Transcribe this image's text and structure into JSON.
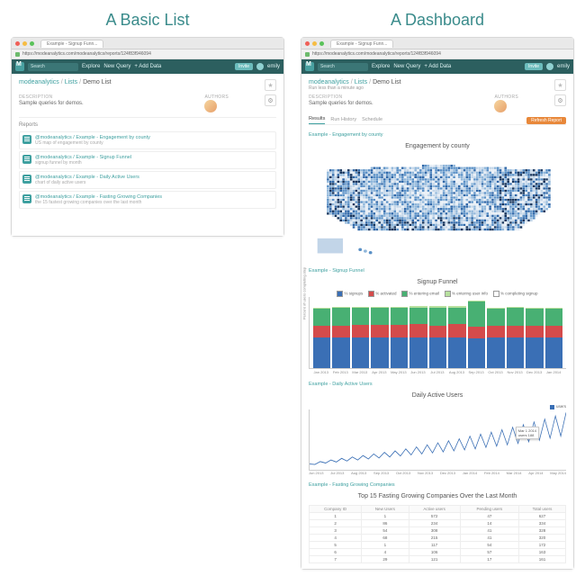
{
  "left": {
    "title": "A Basic List",
    "tab": "Example - Signup Funn...",
    "url": "https://modeanalytics.com/modeanalytics/reports/124f83f946094",
    "nav": {
      "search": "Search",
      "explore": "Explore",
      "new_query": "New Query",
      "add_data": "+ Add Data",
      "invite": "Invite",
      "user": "emily"
    },
    "breadcrumb": {
      "a": "modeanalytics",
      "b": "Lists",
      "c": "Demo List"
    },
    "description_label": "DESCRIPTION",
    "description": "Sample queries for demos.",
    "authors_label": "AUTHORS",
    "reports_header": "Reports",
    "reports": [
      {
        "owner": "@modeanalytics",
        "title": "Example - Engagement by county",
        "sub": "US map of engagement by county"
      },
      {
        "owner": "@modeanalytics",
        "title": "Example - Signup Funnel",
        "sub": "signup funnel by month"
      },
      {
        "owner": "@modeanalytics",
        "title": "Example - Daily Active Users",
        "sub": "chart of daily active users"
      },
      {
        "owner": "@modeanalytics",
        "title": "Example - Fasting Growing Companies",
        "sub": "the 15 fastest growing companies over the last month"
      }
    ]
  },
  "right": {
    "title": "A Dashboard",
    "tab": "Example - Signup Funn...",
    "url": "https://modeanalytics.com/modeanalytics/reports/124f83f946094",
    "nav": {
      "search": "Search",
      "explore": "Explore",
      "new_query": "New Query",
      "add_data": "+ Add Data",
      "invite": "Invite",
      "user": "emily"
    },
    "breadcrumb": {
      "a": "modeanalytics",
      "b": "Lists",
      "c": "Demo List"
    },
    "runtime": "Run less than a minute ago",
    "description_label": "DESCRIPTION",
    "description": "Sample queries for demos.",
    "authors_label": "AUTHORS",
    "tabs": {
      "results": "Results",
      "history": "Run History",
      "schedule": "Schedule",
      "refresh": "Refresh Report"
    },
    "sections": {
      "map": "Example - Engagement by county",
      "funnel": "Example - Signup Funnel",
      "dau": "Example - Daily Active Users",
      "table": "Example - Fasting Growing Companies"
    },
    "map_title": "Engagement by county",
    "funnel_title": "Signup Funnel",
    "dau_title": "Daily Active Users",
    "dau_legend": "users",
    "dau_tooltip": {
      "date": "Mar 1 2014",
      "label": "users",
      "val": "188"
    },
    "table_title": "Top 15 Fasting Growing Companies Over the Last Month"
  },
  "chart_data": [
    {
      "type": "bar",
      "name": "Signup Funnel",
      "ylabel": "Percent of users completing step",
      "ylim": [
        0,
        100
      ],
      "categories": [
        "Jan 2013",
        "Feb 2013",
        "Mar 2013",
        "Apr 2013",
        "May 2013",
        "Jun 2013",
        "Jul 2013",
        "Aug 2013",
        "Sep 2013",
        "Oct 2013",
        "Nov 2013",
        "Dec 2013",
        "Jan 2014"
      ],
      "series": [
        {
          "name": "% signups",
          "color": "#3a6fb5",
          "values": [
            45,
            45,
            45,
            45,
            46,
            46,
            45,
            46,
            44,
            45,
            45,
            45,
            45
          ]
        },
        {
          "name": "% activated",
          "color": "#d44b4b",
          "values": [
            18,
            18,
            19,
            19,
            18,
            19,
            18,
            19,
            17,
            18,
            18,
            18,
            18
          ]
        },
        {
          "name": "% entering email",
          "color": "#48b073",
          "values": [
            25,
            26,
            25,
            25,
            25,
            25,
            27,
            25,
            38,
            25,
            26,
            25,
            25
          ]
        },
        {
          "name": "% entering user info",
          "color": "#b7e09e",
          "values": [
            2,
            2,
            2,
            2,
            2,
            2,
            2,
            2,
            1,
            2,
            2,
            2,
            2
          ]
        },
        {
          "name": "% completing signup",
          "color": "#ffffff",
          "values": [
            10,
            9,
            9,
            9,
            9,
            8,
            8,
            8,
            0,
            10,
            9,
            10,
            10
          ]
        }
      ]
    },
    {
      "type": "line",
      "name": "Daily Active Users",
      "xlabel": "",
      "ylabel": "users",
      "ylim": [
        0,
        300
      ],
      "x_ticks": [
        "Jun 2013",
        "Jul 2013",
        "Aug 2013",
        "Sep 2013",
        "Oct 2013",
        "Nov 2013",
        "Dec 2013",
        "Jan 2014",
        "Feb 2014",
        "Mar 2014",
        "Apr 2014",
        "May 2014"
      ],
      "series": [
        {
          "name": "users",
          "color": "#3a6fb5",
          "values": [
            30,
            28,
            42,
            35,
            50,
            40,
            58,
            45,
            65,
            50,
            72,
            55,
            80,
            60,
            88,
            65,
            95,
            70,
            105,
            75,
            115,
            80,
            125,
            85,
            135,
            90,
            145,
            95,
            155,
            100,
            168,
            105,
            178,
            112,
            188,
            118,
            200,
            125,
            212,
            132,
            225,
            140,
            238,
            148,
            252,
            158,
            268,
            168,
            285
          ]
        }
      ]
    },
    {
      "type": "table",
      "name": "Top 15 Fasting Growing Companies Over the Last Month",
      "columns": [
        "Company ID",
        "New Users",
        "Active users",
        "Pending users",
        "Total users"
      ],
      "rows": [
        [
          1,
          1,
          572,
          47,
          627
        ],
        [
          2,
          86,
          234,
          14,
          334
        ],
        [
          3,
          54,
          308,
          41,
          328
        ],
        [
          4,
          68,
          215,
          41,
          320
        ],
        [
          5,
          1,
          117,
          54,
          172
        ],
        [
          6,
          4,
          106,
          57,
          163
        ],
        [
          7,
          29,
          121,
          17,
          161
        ]
      ]
    }
  ],
  "colors": {
    "teal": "#2c5f5f",
    "link": "#3ea0a0",
    "orange": "#e8883a"
  }
}
